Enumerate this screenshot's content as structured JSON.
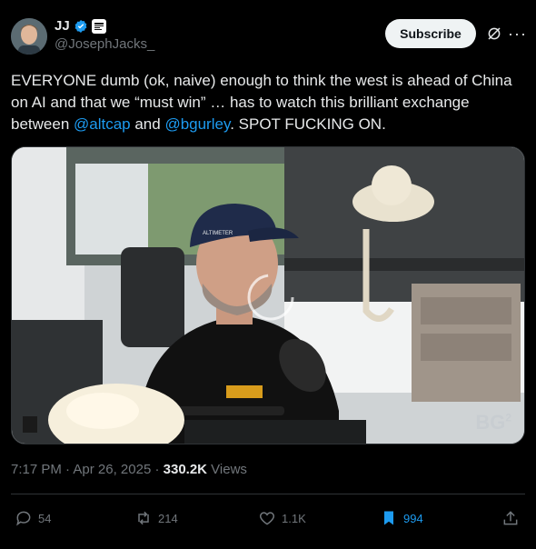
{
  "author": {
    "name": "JJ",
    "handle": "@JosephJacks_"
  },
  "subscribe_label": "Subscribe",
  "tweet": {
    "text_1": "EVERYONE dumb (ok, naive) enough to think the west is ahead of China on AI and that we “must win” … has to watch this brilliant exchange between ",
    "mention_1": "@altcap",
    "text_2": " and ",
    "mention_2": "@bgurley",
    "text_3": ". SPOT FUCKING ON."
  },
  "media": {
    "watermark": "BG",
    "watermark_sup": "2",
    "cap_text": "ALTIMETER"
  },
  "meta": {
    "time": "7:17 PM",
    "sep1": " · ",
    "date": "Apr 26, 2025",
    "sep2": " · ",
    "views_count": "330.2K",
    "views_label": " Views"
  },
  "actions": {
    "replies": "54",
    "reposts": "214",
    "likes": "1.1K",
    "bookmarks": "994"
  },
  "colors": {
    "accent": "#1d9bf0",
    "background": "#000000",
    "secondary_text": "#71767b"
  },
  "icons": [
    "verified-icon",
    "affiliate-badge-icon",
    "grok-icon",
    "more-icon",
    "reply-icon",
    "repost-icon",
    "like-icon",
    "bookmark-icon",
    "share-icon"
  ]
}
